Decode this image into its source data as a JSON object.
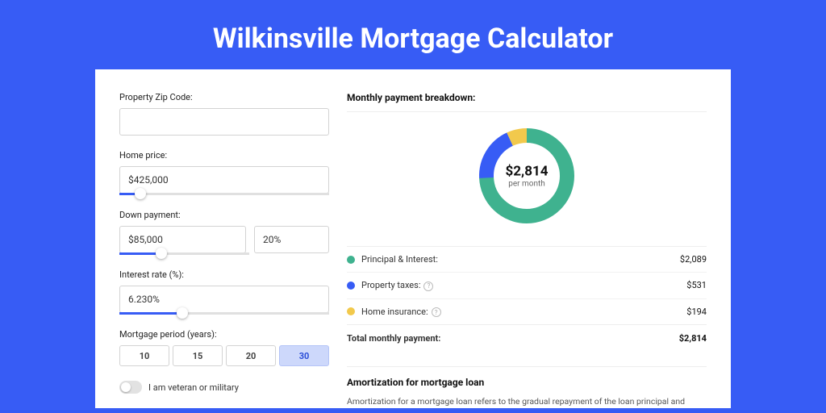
{
  "title": "Wilkinsville Mortgage Calculator",
  "form": {
    "zip_label": "Property Zip Code:",
    "zip_value": "",
    "home_price_label": "Home price:",
    "home_price_value": "$425,000",
    "home_price_slider_pct": 10,
    "down_payment_label": "Down payment:",
    "down_payment_value": "$85,000",
    "down_payment_pct": "20%",
    "down_payment_slider_pct": 20,
    "interest_label": "Interest rate (%):",
    "interest_value": "6.230%",
    "interest_slider_pct": 30,
    "period_label": "Mortgage period (years):",
    "period_options": [
      "10",
      "15",
      "20",
      "30"
    ],
    "period_active": 3,
    "veteran_label": "I am veteran or military"
  },
  "breakdown": {
    "section_title": "Monthly payment breakdown:",
    "center_amount": "$2,814",
    "center_sub": "per month",
    "rows": [
      {
        "label": "Principal & Interest:",
        "value": "$2,089",
        "color": "#3fb28f",
        "info": false
      },
      {
        "label": "Property taxes:",
        "value": "$531",
        "color": "#375cf5",
        "info": true
      },
      {
        "label": "Home insurance:",
        "value": "$194",
        "color": "#f2c94c",
        "info": true
      }
    ],
    "total_label": "Total monthly payment:",
    "total_value": "$2,814"
  },
  "amort": {
    "title": "Amortization for mortgage loan",
    "text": "Amortization for a mortgage loan refers to the gradual repayment of the loan principal and interest over a specified"
  },
  "chart_data": {
    "type": "pie",
    "title": "Monthly payment breakdown",
    "series": [
      {
        "name": "Principal & Interest",
        "value": 2089,
        "color": "#3fb28f"
      },
      {
        "name": "Property taxes",
        "value": 531,
        "color": "#375cf5"
      },
      {
        "name": "Home insurance",
        "value": 194,
        "color": "#f2c94c"
      }
    ],
    "total": 2814
  }
}
